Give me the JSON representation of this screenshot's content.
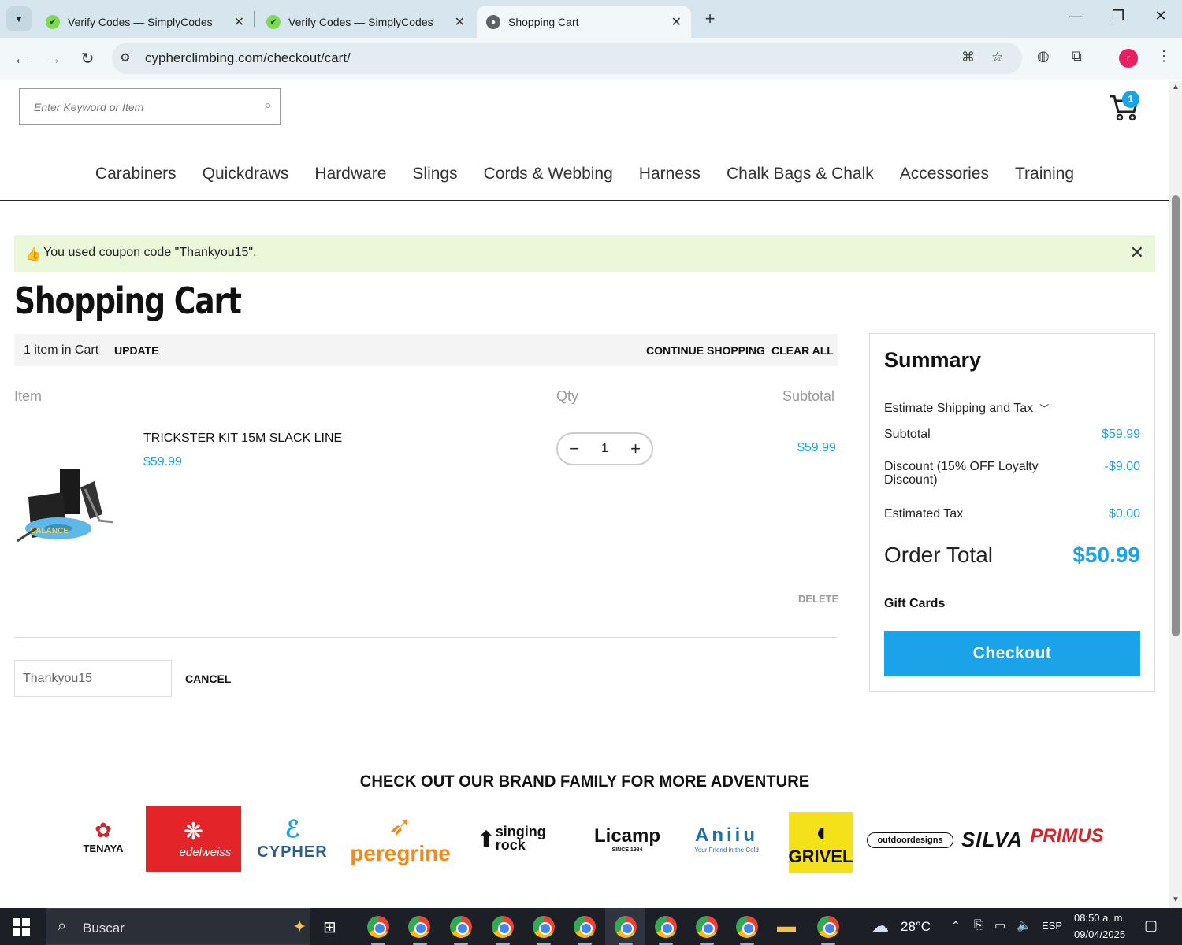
{
  "browser": {
    "tabs": [
      {
        "title": "Verify Codes — SimplyCodes",
        "active": false
      },
      {
        "title": "Verify Codes — SimplyCodes",
        "active": false
      },
      {
        "title": "Shopping Cart",
        "active": true
      }
    ],
    "url": "cypherclimbing.com/checkout/cart/",
    "profile_initial": "r"
  },
  "header": {
    "search_placeholder": "Enter Keyword or Item",
    "cart_count": "1"
  },
  "nav": [
    "Carabiners",
    "Quickdraws",
    "Hardware",
    "Slings",
    "Cords & Webbing",
    "Harness",
    "Chalk Bags & Chalk",
    "Accessories",
    "Training"
  ],
  "notice": {
    "message": "You used coupon code \"Thankyou15\"."
  },
  "page_title": "Shopping Cart",
  "cart_bar": {
    "count": "1 item in Cart",
    "update": "UPDATE",
    "continue": "CONTINUE SHOPPING",
    "clear": "CLEAR ALL"
  },
  "columns": {
    "item": "Item",
    "qty": "Qty",
    "subtotal": "Subtotal"
  },
  "item": {
    "name": "TRICKSTER KIT 15M SLACK LINE",
    "price": "$59.99",
    "qty": "1",
    "subtotal": "$59.99",
    "delete": "DELETE",
    "image_text": "BALANCE"
  },
  "coupon": {
    "value": "Thankyou15",
    "cancel": "CANCEL"
  },
  "summary": {
    "title": "Summary",
    "estimate": "Estimate Shipping and Tax",
    "subtotal_label": "Subtotal",
    "subtotal": "$59.99",
    "discount_label": "Discount (15% OFF Loyalty Discount)",
    "discount": "-$9.00",
    "tax_label": "Estimated Tax",
    "tax": "$0.00",
    "total_label": "Order Total",
    "total": "$50.99",
    "gift": "Gift Cards",
    "checkout": "Checkout"
  },
  "brands": {
    "heading": "CHECK OUT OUR BRAND FAMILY FOR MORE ADVENTURE",
    "tenaya": "TENAYA",
    "edelweiss": "edelweiss",
    "cypher": "CYPHER",
    "peregrine": "peregrine",
    "singing_rock": "singing rock",
    "licamp": "Licamp",
    "licamp_sub": "SINCE 1984",
    "aniiu": "Aniiu",
    "aniiu_sub": "Your Friend in the Cold",
    "grivel": "GRIVEL",
    "outdoordesigns": "outdoordesigns",
    "silva": "SILVA",
    "primus": "PRIMUS"
  },
  "taskbar": {
    "search": "Buscar",
    "weather": "28°C",
    "lang": "ESP",
    "time": "08:50 a. m.",
    "date": "09/04/2025"
  },
  "colors": {
    "accent": "#1aa3e8",
    "notice_bg": "#eaf7d9"
  }
}
